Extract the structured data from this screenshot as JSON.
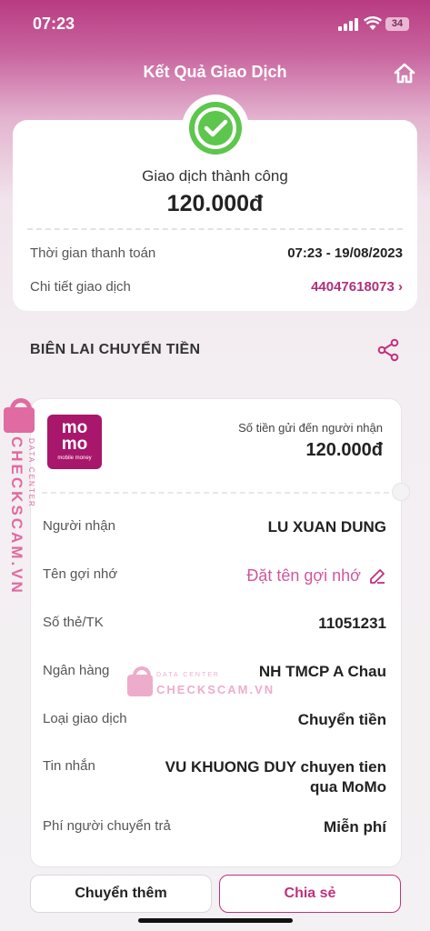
{
  "status_bar": {
    "time": "07:23",
    "battery": "34"
  },
  "header": {
    "title": "Kết Quả Giao Dịch"
  },
  "result": {
    "status": "Giao dịch thành công",
    "amount": "120.000đ"
  },
  "summary": [
    {
      "label": "Thời gian thanh toán",
      "value": "07:23 - 19/08/2023"
    },
    {
      "label": "Chi tiết giao dịch",
      "value": "44047618073 ›"
    }
  ],
  "receipt": {
    "section_title": "BIÊN LAI CHUYỂN TIỀN",
    "logo": {
      "line1": "mo",
      "line2": "mo",
      "tag": "mobile money"
    },
    "sent_label": "Số tiền gửi đến người nhận",
    "sent_amount": "120.000đ",
    "rows": [
      {
        "label": "Người nhận",
        "value": "LU XUAN DUNG"
      },
      {
        "label": "Tên gợi nhớ",
        "value": "Đặt tên gợi nhớ"
      },
      {
        "label": "Số thẻ/TK",
        "value": "11051231"
      },
      {
        "label": "Ngân hàng",
        "value": "NH TMCP A Chau"
      },
      {
        "label": "Loại giao dịch",
        "value": "Chuyển tiền"
      },
      {
        "label": "Tin nhắn",
        "value": "VU KHUONG DUY chuyen tien",
        "value2": "qua MoMo"
      },
      {
        "label": "Phí người chuyển trả",
        "value": "Miễn phí"
      }
    ]
  },
  "watermark": {
    "brand": "CHECKSCAM.VN",
    "sub": "DATA CENTER"
  },
  "buttons": {
    "transfer_more": "Chuyển thêm",
    "share": "Chia sẻ"
  },
  "colors": {
    "brand": "#a8176b",
    "accent": "#c2307d",
    "success": "#5dc64d"
  }
}
